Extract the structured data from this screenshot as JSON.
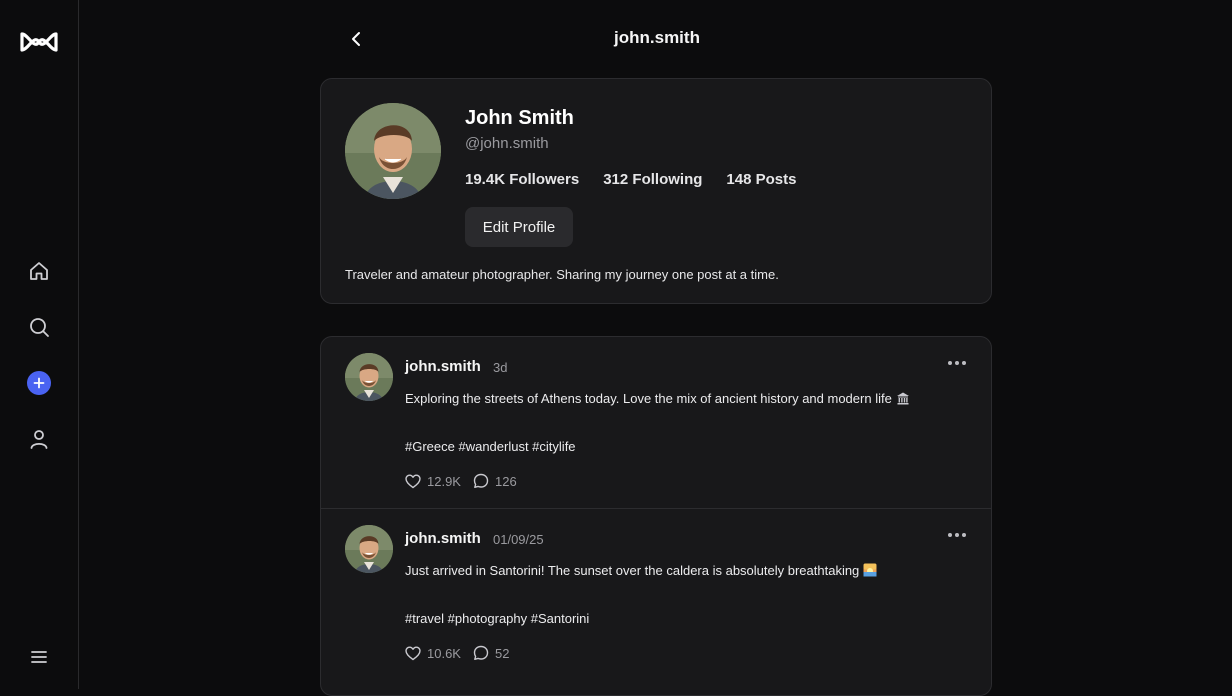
{
  "header": {
    "title": "john.smith"
  },
  "profile": {
    "name": "John Smith",
    "handle": "@john.smith",
    "followers": "19.4K Followers",
    "following": "312 Following",
    "posts": "148 Posts",
    "edit_label": "Edit Profile",
    "bio": "Traveler and amateur photographer. Sharing my journey one post at a time."
  },
  "posts": [
    {
      "user": "john.smith",
      "time": "3d",
      "text": "Exploring the streets of Athens today. Love the mix of ancient history and modern life",
      "emoji": "classical-building-icon",
      "tags": "#Greece #wanderlust #citylife",
      "likes": "12.9K",
      "comments": "126"
    },
    {
      "user": "john.smith",
      "time": "01/09/25",
      "text": "Just arrived in Santorini! The sunset over the caldera is absolutely breathtaking",
      "emoji": "sunset-icon",
      "tags": "#travel #photography #Santorini",
      "likes": "10.6K",
      "comments": "52"
    }
  ],
  "colors": {
    "background": "#0c0c0d",
    "card": "#18181a",
    "accent": "#4a63f2"
  }
}
